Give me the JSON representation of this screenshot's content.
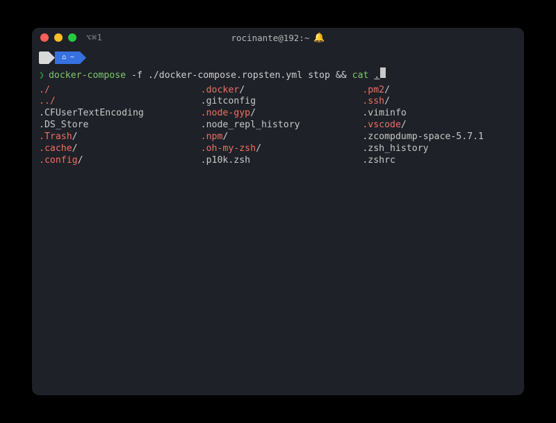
{
  "titlebar": {
    "tab_label": "⌥⌘1",
    "title": "rocinante@192:~",
    "bell": "🔔"
  },
  "prompt_segments": {
    "apple": "",
    "home": "⌂ ~"
  },
  "prompt": {
    "chevron": "❯",
    "cmd1": "docker-compose",
    "flag": " -f ",
    "arg": "./docker-compose.ropsten.yml stop ",
    "op": "&&",
    "cmd2": " cat ",
    "typed": "."
  },
  "listing": {
    "col1": [
      {
        "name": "./",
        "dir": true
      },
      {
        "name": "../",
        "dir": true
      },
      {
        "name": ".CFUserTextEncoding",
        "dir": false
      },
      {
        "name": ".DS_Store",
        "dir": false
      },
      {
        "name": ".Trash",
        "suffix": "/",
        "dir": true
      },
      {
        "name": ".cache",
        "suffix": "/",
        "dir": true
      },
      {
        "name": ".config",
        "suffix": "/",
        "dir": true
      }
    ],
    "col2": [
      {
        "name": ".docker",
        "suffix": "/",
        "dir": true
      },
      {
        "name": ".gitconfig",
        "dir": false
      },
      {
        "name": ".node-gyp",
        "suffix": "/",
        "dir": true
      },
      {
        "name": ".node_repl_history",
        "dir": false
      },
      {
        "name": ".npm",
        "suffix": "/",
        "dir": true
      },
      {
        "name": ".oh-my-zsh",
        "suffix": "/",
        "dir": true
      },
      {
        "name": ".p10k.zsh",
        "dir": false
      }
    ],
    "col3": [
      {
        "name": ".pm2",
        "suffix": "/",
        "dir": true
      },
      {
        "name": ".ssh",
        "suffix": "/",
        "dir": true
      },
      {
        "name": ".viminfo",
        "dir": false
      },
      {
        "name": ".vscode",
        "suffix": "/",
        "dir": true
      },
      {
        "name": ".zcompdump-space-5.7.1",
        "dir": false
      },
      {
        "name": ".zsh_history",
        "dir": false
      },
      {
        "name": ".zshrc",
        "dir": false
      }
    ]
  }
}
